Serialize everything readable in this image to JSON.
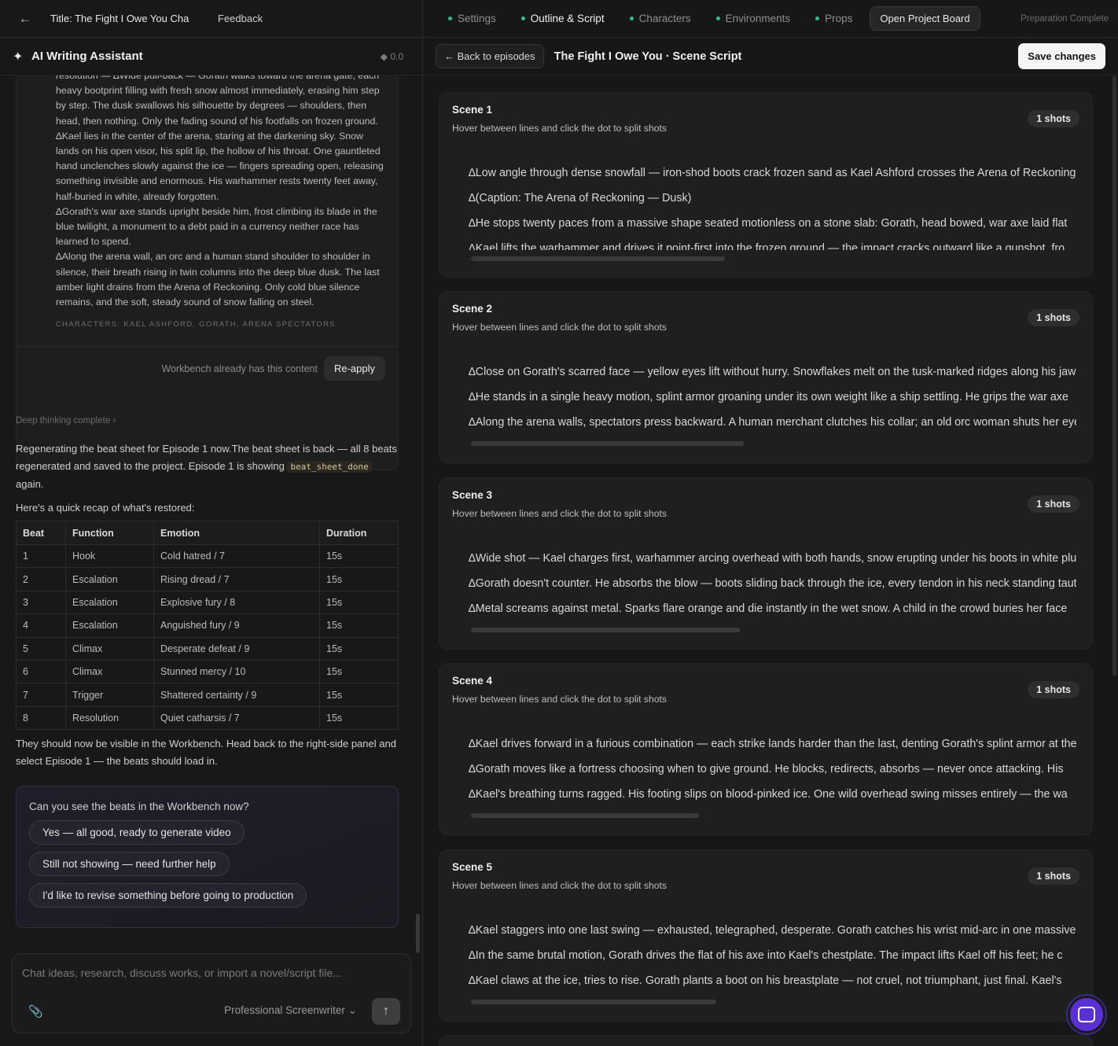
{
  "topbar": {
    "project_title": "Title: The Fight I Owe You Cha",
    "feedback": "Feedback"
  },
  "assistant": {
    "title": "AI Writing Assistant",
    "credit": "◆ 0.0"
  },
  "script_card": {
    "paragraphs": [
      "resolution — ∆Wide pull-back — Gorath walks toward the arena gate, each heavy bootprint filling with fresh snow almost immediately, erasing him step by step. The dusk swallows his silhouette by degrees — shoulders, then head, then nothing. Only the fading sound of his footfalls on frozen ground.",
      "∆Kael lies in the center of the arena, staring at the darkening sky. Snow lands on his open visor, his split lip, the hollow of his throat. One gauntleted hand unclenches slowly against the ice — fingers spreading open, releasing something invisible and enormous. His warhammer rests twenty feet away, half-buried in white, already forgotten.",
      "∆Gorath's war axe stands upright beside him, frost climbing its blade in the blue twilight, a monument to a debt paid in a currency neither race has learned to spend.",
      "∆Along the arena wall, an orc and a human stand shoulder to shoulder in silence, their breath rising in twin columns into the deep blue dusk. The last amber light drains from the Arena of Reckoning. Only cold blue silence remains, and the soft, steady sound of snow falling on steel."
    ],
    "characters_line": "CHARACTERS: KAEL ASHFORD, GORATH, ARENA SPECTATORS",
    "footer_note": "Workbench already has this content",
    "reapply": "Re-apply"
  },
  "deep_thinking": "Deep thinking complete  ›",
  "message": {
    "intro_1": "Regenerating the beat sheet for Episode 1 now.The beat sheet is back — all 8 beats regenerated and saved to the project. Episode 1 is showing ",
    "code": "beat_sheet_done",
    "intro_2": " again.",
    "recap": "Here's a quick recap of what's restored:",
    "outro": "They should now be visible in the Workbench. Head back to the right-side panel and select Episode 1 — the beats should load in."
  },
  "beats_table": {
    "headers": [
      "Beat",
      "Function",
      "Emotion",
      "Duration"
    ],
    "rows": [
      [
        "1",
        "Hook",
        "Cold hatred / 7",
        "15s"
      ],
      [
        "2",
        "Escalation",
        "Rising dread / 7",
        "15s"
      ],
      [
        "3",
        "Escalation",
        "Explosive fury / 8",
        "15s"
      ],
      [
        "4",
        "Escalation",
        "Anguished fury / 9",
        "15s"
      ],
      [
        "5",
        "Climax",
        "Desperate defeat / 9",
        "15s"
      ],
      [
        "6",
        "Climax",
        "Stunned mercy / 10",
        "15s"
      ],
      [
        "7",
        "Trigger",
        "Shattered certainty / 9",
        "15s"
      ],
      [
        "8",
        "Resolution",
        "Quiet catharsis / 7",
        "15s"
      ]
    ]
  },
  "question": {
    "text": "Can you see the beats in the Workbench now?",
    "options": [
      "Yes — all good, ready to generate video",
      "Still not showing — need further help",
      "I'd like to revise something before going to production"
    ]
  },
  "composer": {
    "placeholder": "Chat ideas, research, discuss works, or import a novel/script file...",
    "persona": "Professional Screenwriter  ⌄",
    "send_icon": "arrow-up-icon",
    "attach_icon": "paperclip-icon"
  },
  "tabs": [
    "Settings",
    "Outline & Script",
    "Characters",
    "Environments",
    "Props"
  ],
  "active_tab": "Outline & Script",
  "open_board": "Open Project Board",
  "prep_status": "Preparation Complete",
  "subbar": {
    "back": "Back to episodes",
    "title": "The Fight I Owe You · Scene Script",
    "save": "Save changes"
  },
  "scenes": [
    {
      "title": "Scene 1",
      "hint": "Hover between lines and click the dot to split shots",
      "shots": "1 shots",
      "lines": [
        "∆Low angle through dense snowfall — iron-shod boots crack frozen sand as Kael Ashford crosses the Arena of Reckoning",
        "∆(Caption: The Arena of Reckoning — Dusk)",
        "∆He stops twenty paces from a massive shape seated motionless on a stone slab: Gorath, head bowed, war axe laid flat",
        "∆Kael lifts the warhammer and drives it point-first into the frozen ground — the impact cracks outward like a gunshot, fro"
      ]
    },
    {
      "title": "Scene 2",
      "hint": "Hover between lines and click the dot to split shots",
      "shots": "1 shots",
      "lines": [
        "∆Close on Gorath's scarred face — yellow eyes lift without hurry. Snowflakes melt on the tusk-marked ridges along his jaw",
        "∆He stands in a single heavy motion, splint armor groaning under its own weight like a ship settling. He grips the war axe",
        "∆Along the arena walls, spectators press backward. A human merchant clutches his collar; an old orc woman shuts her eyes"
      ]
    },
    {
      "title": "Scene 3",
      "hint": "Hover between lines and click the dot to split shots",
      "shots": "1 shots",
      "lines": [
        "∆Wide shot — Kael charges first, warhammer arcing overhead with both hands, snow erupting under his boots in white plumes",
        "∆Gorath doesn't counter. He absorbs the blow — boots sliding back through the ice, every tendon in his neck standing taut",
        "∆Metal screams against metal. Sparks flare orange and die instantly in the wet snow. A child in the crowd buries her face"
      ]
    },
    {
      "title": "Scene 4",
      "hint": "Hover between lines and click the dot to split shots",
      "shots": "1 shots",
      "lines": [
        "∆Kael drives forward in a furious combination — each strike lands harder than the last, denting Gorath's splint armor at the",
        "∆Gorath moves like a fortress choosing when to give ground. He blocks, redirects, absorbs — never once attacking. His",
        "∆Kael's breathing turns ragged. His footing slips on blood-pinked ice. One wild overhead swing misses entirely — the wa"
      ]
    },
    {
      "title": "Scene 5",
      "hint": "Hover between lines and click the dot to split shots",
      "shots": "1 shots",
      "lines": [
        "∆Kael staggers into one last swing — exhausted, telegraphed, desperate. Gorath catches his wrist mid-arc in one massive",
        "∆In the same brutal motion, Gorath drives the flat of his axe into Kael's chestplate. The impact lifts Kael off his feet; he c",
        "∆Kael claws at the ice, tries to rise. Gorath plants a boot on his breastplate — not cruel, not triumphant, just final. Kael's"
      ]
    }
  ],
  "colors": {
    "tab_dot": "#2fbf8a",
    "bubble": "#5a2fd4"
  }
}
